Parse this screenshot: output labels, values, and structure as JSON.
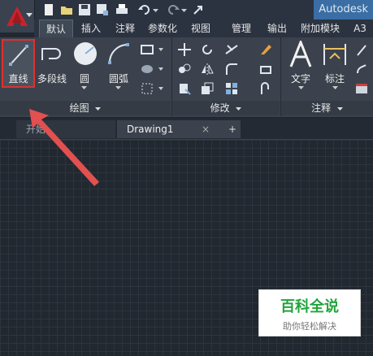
{
  "app": {
    "title": "Autodesk",
    "logo_icon": "autocad-a-logo-icon"
  },
  "quick_access": [
    "new-icon",
    "open-icon",
    "save-icon",
    "save-as-icon",
    "print-icon",
    "undo-icon",
    "redo-icon",
    "share-icon"
  ],
  "tabs": [
    {
      "label": "默认",
      "active": true
    },
    {
      "label": "插入",
      "active": false
    },
    {
      "label": "注释",
      "active": false
    },
    {
      "label": "参数化",
      "active": false
    },
    {
      "label": "视图",
      "active": false
    },
    {
      "label": "管理",
      "active": false
    },
    {
      "label": "输出",
      "active": false
    },
    {
      "label": "附加模块",
      "active": false
    },
    {
      "label": "A3",
      "active": false
    }
  ],
  "ribbon": {
    "draw": {
      "title": "绘图",
      "line_label": "直线",
      "polyline_label": "多段线",
      "circle_label": "圆",
      "arc_label": "圆弧"
    },
    "modify": {
      "title": "修改"
    },
    "annotation": {
      "title": "注释",
      "text_label": "文字",
      "dimension_label": "标注"
    }
  },
  "file_tabs": [
    {
      "label": "开始"
    },
    {
      "label": "Drawing1"
    }
  ],
  "watermark": {
    "title": "百科全说",
    "subtitle": "助你轻松解决"
  },
  "colors": {
    "accent": "#3a6ea5",
    "highlight": "#e03030",
    "arrow": "#e25050"
  }
}
